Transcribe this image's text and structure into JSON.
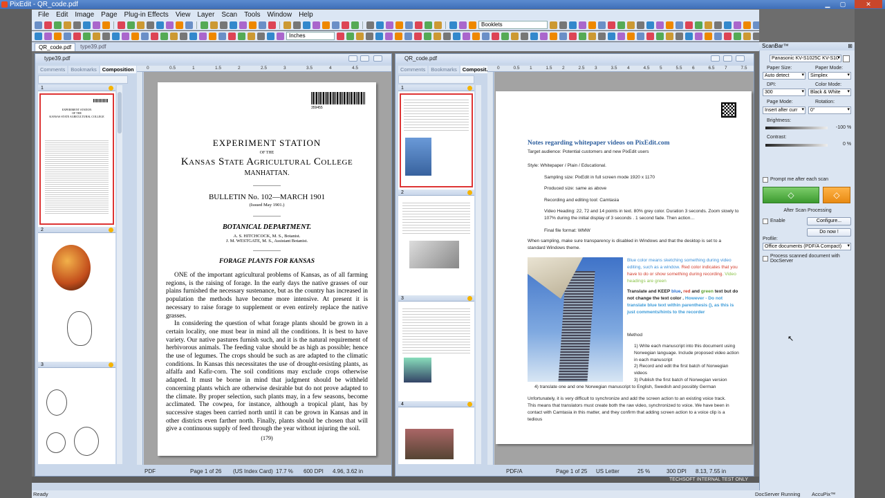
{
  "app": {
    "title": "PixEdit - QR_code.pdf"
  },
  "menu": [
    "File",
    "Edit",
    "Image",
    "Page",
    "Plug-in Effects",
    "View",
    "Layer",
    "Scan",
    "Tools",
    "Window",
    "Help"
  ],
  "toolbar": {
    "units": "Inches",
    "profile_combo": "Booklets"
  },
  "tabs": [
    "QR_code.pdf",
    "type39.pdf"
  ],
  "left_doc": {
    "title": "type39.pdf",
    "panel_tabs": [
      "Comments",
      "Bookmarks",
      "Composition"
    ],
    "thumb_labels": [
      "1",
      "2",
      "3"
    ],
    "page": {
      "barcode_num": "359455",
      "line1": "EXPERIMENT STATION",
      "line2": "OF THE",
      "line3": "Kansas State Agricultural College",
      "line4": "MANHATTAN.",
      "bulletin": "BULLETIN No. 102—MARCH 1901",
      "issued": "(Issued May 1901.)",
      "dept": "BOTANICAL DEPARTMENT.",
      "auth1": "A. S. HITCHCOCK, M. S., Botanist.",
      "auth2": "J. M. WESTGATE, M. S., Assistant Botanist.",
      "heading": "FORAGE PLANTS FOR KANSAS",
      "para1": "ONE of the important agricultural problems of Kansas, as of all farming regions, is the raising of forage. In the early days the native grasses of our plains furnished the necessary sustenance, but as the country has increased in population the methods have become more intensive. At present it is necessary to raise forage to supplement or even entirely replace the native grasses.",
      "para2": "In considering the question of what forage plants should be grown in a certain locality, one must bear in mind all the conditions. It is best to have variety. Our native pastures furnish such, and it is the natural requirement of herbivorous animals. The feeding value should be as high as possible; hence the use of legumes. The crops should be such as are adapted to the climatic conditions. In Kansas this necessitates the use of drought-resisting plants, as alfalfa and Kafir-corn. The soil conditions may exclude crops otherwise adapted. It must be borne in mind that judgment should be withheld concerning plants which are otherwise desirable but do not prove adapted to the climate. By proper selection, such plants may, in a few seasons, become acclimated. The cowpea, for instance, although a tropical plant, has by successive stages been carried north until it can be grown in Kansas and in other districts even farther north. Finally, plants should be chosen that will give a continuous supply of feed through the year without injuring the soil.",
      "pagenum": "(179)"
    },
    "status": {
      "format": "PDF",
      "pages": "Page 1 of 26",
      "size": "(US Index Card)",
      "zoom": "17.7 %",
      "dpi": "600 DPI",
      "dims": "4.96, 3.62 in"
    }
  },
  "right_doc": {
    "title": "QR_code.pdf",
    "panel_tabs": [
      "Comments",
      "Bookmarks",
      "Composit..."
    ],
    "thumb_labels": [
      "1",
      "2",
      "3",
      "4"
    ],
    "page": {
      "heading": "Notes regarding whitepaper videos on PixEdit.com",
      "audience": "Target audience: Potential customers and new PixEdit users",
      "style": "Style: Whitepaper / Plain / Educational.",
      "sampling": "Sampling size:   PixEdit in full screen mode 1920 x 1170",
      "produced": "Produced size: same as above",
      "recording": "Recording and editing tool: Camtasia",
      "videoheading": "Video Heading: 22, 72 and 14 points in text. 80% grey color. Duration 3 seconds. Zoom slowly to 107% during the initial display of 3 seconds . 1 second fade. Then action…",
      "final": "Final file format: WMW",
      "sampling2": "When sampling, make sure transparency is disabled in Windows and that the desktop is set to a standard Windows theme.",
      "blue_text": "Blue color means sketching something during video editing, such as a window.",
      "red_text": "Red color indicates that you have to do or show something during recording.",
      "green_text": "Video headings are green",
      "translate_a": "Translate and KEEP ",
      "translate_blue": "blue",
      "translate_b": ", ",
      "translate_red": "red",
      "translate_c": " and ",
      "translate_green": "green",
      "translate_d": " text but do not change the text color . ",
      "translate_e": "However - Do not translate blue text within parenthesis (), as this is just comments/hints to the recorder",
      "method": "Method",
      "m1": "1)     Write each manuscript into this document using Norwegian language. Include proposed video action in each manuscript",
      "m2": "2)     Record and edit the first batch of Norwegian videos",
      "m3": "3)     Publish the first batch of Norwegian version",
      "m4": "4)    translate  one and one Norwegian manuscript to English, Swedish and possibly German",
      "unfortunately": "Unfortunately, it is very difficult to synchronize and add the screen action to an existing voice track. This means that translators must create both the raw video, synchronized to voice. We have been in contact with Camtasia in this matter, and they confirm that adding screen action to a voice clip is a tedious"
    },
    "status": {
      "format": "PDF/A",
      "pages": "Page 1 of 25",
      "size": "US Letter",
      "zoom": "25 %",
      "dpi": "300 DPI",
      "dims": "8.13, 7.55 in"
    }
  },
  "watermark": "TECHSOFT INTERNAL TEST ONLY",
  "scanbar": {
    "title": "ScanBar™",
    "scanner": "Panasonic KV-S1025C KV-S10",
    "paper_size_label": "Paper Size:",
    "paper_size": "Auto detect",
    "paper_mode_label": "Paper Mode:",
    "paper_mode": "Simplex",
    "dpi_label": "DPI:",
    "dpi": "300",
    "color_mode_label": "Color Mode:",
    "color_mode": "Black & White",
    "page_mode_label": "Page Mode:",
    "page_mode": "Insert after curr",
    "rotation_label": "Rotation:",
    "rotation": "0°",
    "brightness_label": "Brightness:",
    "brightness": "-100 %",
    "contrast_label": "Contrast:",
    "contrast": "0 %",
    "prompt": "Prompt me after each scan",
    "after_scan": "After Scan Processing",
    "enable": "Enable",
    "configure": "Configure...",
    "do_now": "Do now !",
    "profile_label": "Profile:",
    "profile": "Office documents (PDF/A Compact)",
    "process_server": "Process scanned document with DocServer"
  },
  "statusbar": {
    "left": "Ready",
    "docserver": "DocServer Running",
    "accupix": "AccuPix™"
  },
  "left_ruler": [
    "0",
    "0.5",
    "1",
    "1.5",
    "2",
    "2.5",
    "3",
    "3.5",
    "4",
    "4.5"
  ],
  "right_ruler": [
    "0",
    "0.5",
    "1",
    "1.5",
    "2",
    "2.5",
    "3",
    "3.5",
    "4",
    "4.5",
    "5",
    "5.5",
    "6",
    "6.5",
    "7",
    "7.5"
  ]
}
